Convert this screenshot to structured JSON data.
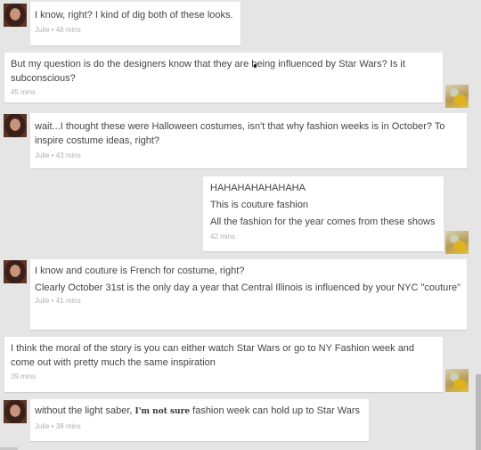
{
  "messages": [
    {
      "sender": "Julie",
      "side": "left",
      "lines": [
        "I know, right? I kind of dig both of these looks."
      ],
      "time": "Julie • 48 mins"
    },
    {
      "sender": "other",
      "side": "right",
      "lines": [
        "But my question is do the designers know that they are being influenced by Star Wars? Is it subconscious?"
      ],
      "time": "45 mins"
    },
    {
      "sender": "Julie",
      "side": "left",
      "lines": [
        "wait...I thought these were Halloween costumes, isn't that why fashion weeks is in October? To inspire costume ideas, right?"
      ],
      "time": "Julie • 43 mins"
    },
    {
      "sender": "other",
      "side": "right",
      "lines": [
        "HAHAHAHAHAHAHA",
        "This is couture fashion",
        "All the fashion for the year comes from these shows"
      ],
      "time": "42 mins"
    },
    {
      "sender": "Julie",
      "side": "left",
      "lines": [
        "I know and couture is French for costume, right?",
        "Clearly October 31st is the only day a year that Central Illinois is influenced by your NYC \"couture\""
      ],
      "time": "Julie • 41 mins"
    },
    {
      "sender": "other",
      "side": "right",
      "lines": [
        "I think the moral of the story is you can either watch Star Wars or go to NY Fashion week and come out with pretty much the same inspiration"
      ],
      "time": "39 mins"
    },
    {
      "sender": "Julie",
      "side": "left",
      "lines_parts": [
        "without the light saber,",
        "I'm not sure",
        "fashion week can hold up to Star Wars"
      ],
      "time": "Julie • 38 mins"
    }
  ]
}
